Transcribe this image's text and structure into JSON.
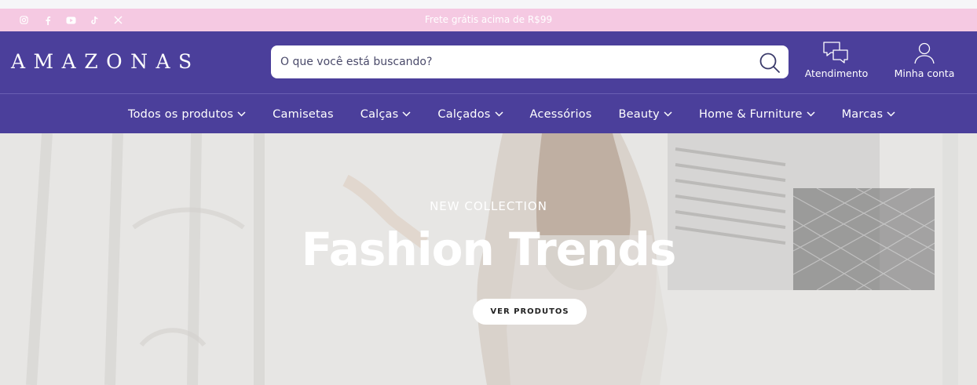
{
  "announcement": {
    "text": "Frete grátis acima de R$99",
    "social_icons": [
      "instagram-icon",
      "facebook-icon",
      "youtube-icon",
      "tiktok-icon",
      "x-icon"
    ]
  },
  "header": {
    "logo": "AMAZONAS",
    "search": {
      "placeholder": "O que você está buscando?",
      "value": ""
    },
    "support_label": "Atendimento",
    "account_label": "Minha conta"
  },
  "nav": {
    "items": [
      {
        "label": "Todos os produtos",
        "dropdown": true
      },
      {
        "label": "Camisetas",
        "dropdown": false
      },
      {
        "label": "Calças",
        "dropdown": true
      },
      {
        "label": "Calçados",
        "dropdown": true
      },
      {
        "label": "Acessórios",
        "dropdown": false
      },
      {
        "label": "Beauty",
        "dropdown": true
      },
      {
        "label": "Home & Furniture",
        "dropdown": true
      },
      {
        "label": "Marcas",
        "dropdown": true
      }
    ]
  },
  "hero": {
    "eyebrow": "NEW COLLECTION",
    "title": "Fashion Trends",
    "cta": "VER PRODUTOS"
  },
  "colors": {
    "brand": "#4b3f9b",
    "announcement_bg": "#f5c9e2",
    "white": "#ffffff"
  }
}
